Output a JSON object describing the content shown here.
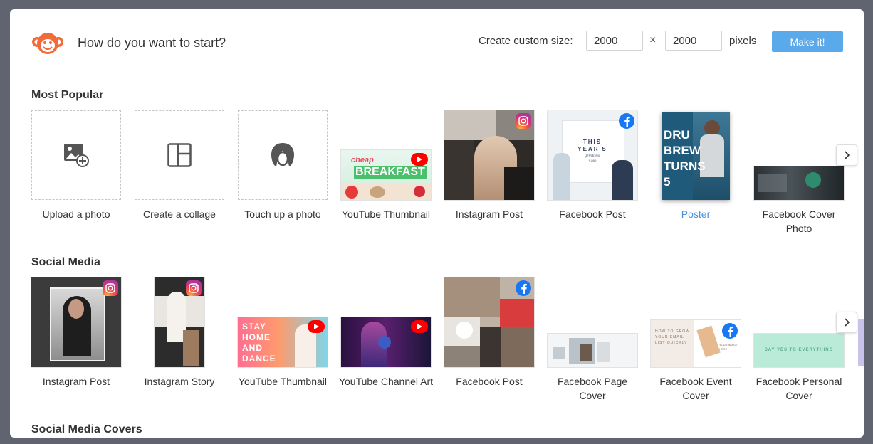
{
  "dialog": {
    "title": "How do you want to start?",
    "custom_size_label": "Create custom size:",
    "width_value": "2000",
    "height_value": "2000",
    "times_symbol": "×",
    "pixels_label": "pixels",
    "make_button": "Make it!"
  },
  "sections": {
    "most_popular": {
      "title": "Most Popular",
      "items": [
        {
          "label": "Upload a photo",
          "icon": "upload-photo-icon"
        },
        {
          "label": "Create a collage",
          "icon": "collage-icon"
        },
        {
          "label": "Touch up a photo",
          "icon": "touch-up-face-icon"
        },
        {
          "label": "YouTube Thumbnail",
          "badge": "youtube-icon",
          "thumb_text_1": "cheap",
          "thumb_text_2": "BREAKFAST"
        },
        {
          "label": "Instagram Post",
          "badge": "instagram-icon"
        },
        {
          "label": "Facebook Post",
          "badge": "facebook-icon",
          "thumb_text_1": "THIS",
          "thumb_text_2": "YEAR'S",
          "thumb_text_3": "greatest",
          "thumb_text_4": "sale"
        },
        {
          "label": "Poster",
          "thumb_text_1": "DRU",
          "thumb_text_2": "BREW",
          "thumb_text_3": "TURNS",
          "thumb_text_4": "5"
        },
        {
          "label": "Facebook Cover Photo"
        }
      ]
    },
    "social_media": {
      "title": "Social Media",
      "items": [
        {
          "label": "Instagram Post",
          "badge": "instagram-icon"
        },
        {
          "label": "Instagram Story",
          "badge": "instagram-icon"
        },
        {
          "label": "YouTube Thumbnail",
          "badge": "youtube-icon",
          "thumb_text": "STAY HOME AND DANCE"
        },
        {
          "label": "YouTube Channel Art",
          "badge": "youtube-icon"
        },
        {
          "label": "Facebook Post",
          "badge": "facebook-icon"
        },
        {
          "label": "Facebook Page Cover"
        },
        {
          "label": "Facebook Event Cover",
          "badge": "facebook-icon",
          "thumb_text_1": "HOW TO GROW YOUR EMAIL LIST QUICKLY",
          "thumb_text_2": "YOUR IMAGE HERE"
        },
        {
          "label": "Facebook Personal Cover",
          "thumb_text": "SAY YES TO EVERYTHING"
        }
      ]
    },
    "social_media_covers": {
      "title": "Social Media Covers"
    }
  },
  "colors": {
    "accent": "#5aa9ea",
    "active_label": "#4a90d9",
    "logo": "#f26b3a"
  }
}
